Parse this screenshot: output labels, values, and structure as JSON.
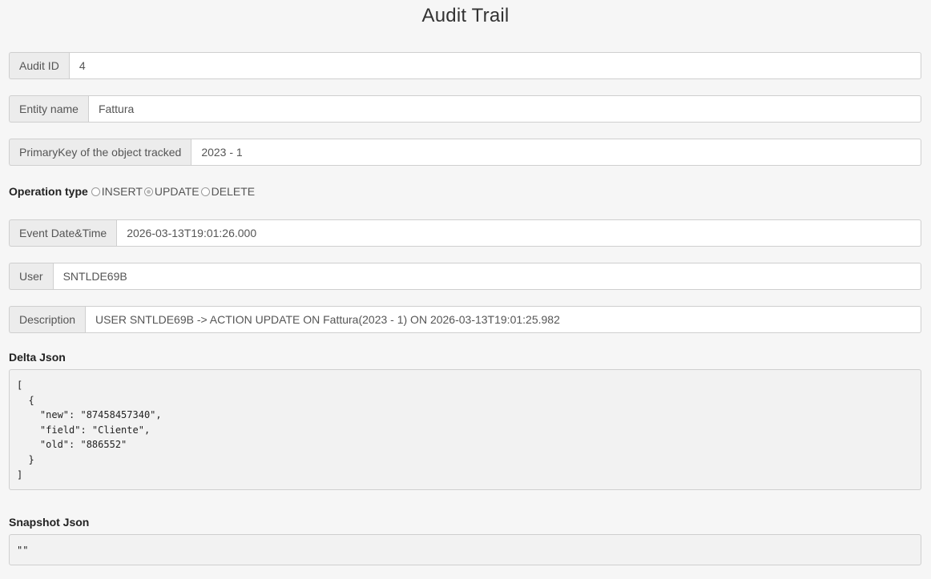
{
  "page": {
    "title": "Audit Trail"
  },
  "fields": {
    "audit_id": {
      "label": "Audit ID",
      "value": "4"
    },
    "entity_name": {
      "label": "Entity name",
      "value": "Fattura"
    },
    "primary_key": {
      "label": "PrimaryKey of the object tracked",
      "value": "2023 - 1"
    },
    "event_datetime": {
      "label": "Event Date&Time",
      "value": "2026-03-13T19:01:26.000"
    },
    "user": {
      "label": "User",
      "value": "SNTLDE69B"
    },
    "description": {
      "label": "Description",
      "value": "USER SNTLDE69B -> ACTION UPDATE ON Fattura(2023 - 1) ON 2026-03-13T19:01:25.982"
    }
  },
  "operation_type": {
    "label": "Operation type",
    "options": [
      {
        "label": "INSERT",
        "checked": false
      },
      {
        "label": "UPDATE",
        "checked": true
      },
      {
        "label": "DELETE",
        "checked": false
      }
    ]
  },
  "delta_json": {
    "heading": "Delta Json",
    "content": "[\n  {\n    \"new\": \"87458457340\",\n    \"field\": \"Cliente\",\n    \"old\": \"886552\"\n  }\n]"
  },
  "snapshot_json": {
    "heading": "Snapshot Json",
    "content": "\"\""
  }
}
